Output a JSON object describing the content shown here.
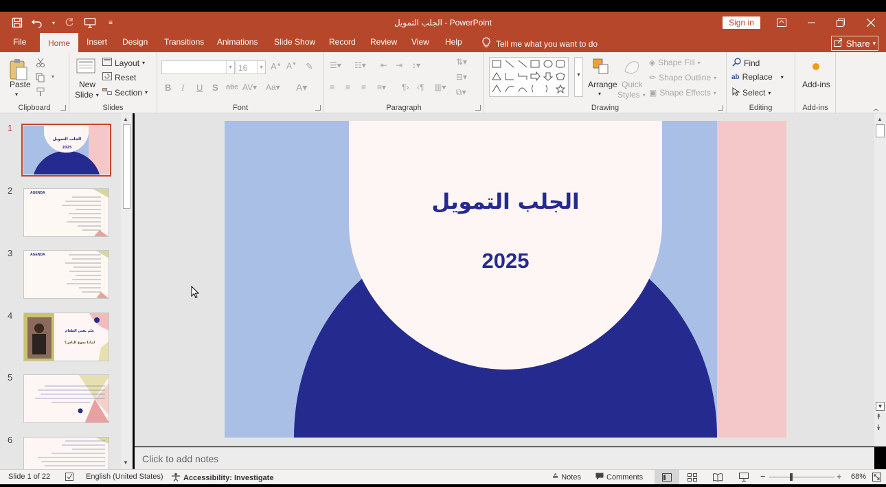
{
  "window": {
    "title": "الجلب التمويل  -  PowerPoint",
    "sign_in": "Sign in"
  },
  "tabs": [
    {
      "label": "File"
    },
    {
      "label": "Home"
    },
    {
      "label": "Insert"
    },
    {
      "label": "Design"
    },
    {
      "label": "Transitions"
    },
    {
      "label": "Animations"
    },
    {
      "label": "Slide Show"
    },
    {
      "label": "Record"
    },
    {
      "label": "Review"
    },
    {
      "label": "View"
    },
    {
      "label": "Help"
    }
  ],
  "tell_me": "Tell me what you want to do",
  "share": "Share",
  "ribbon": {
    "clipboard": {
      "paste": "Paste",
      "label": "Clipboard"
    },
    "slides": {
      "new_slide_1": "New",
      "new_slide_2": "Slide",
      "layout": "Layout",
      "reset": "Reset",
      "section": "Section",
      "label": "Slides"
    },
    "font": {
      "size": "16",
      "label": "Font"
    },
    "paragraph": {
      "label": "Paragraph"
    },
    "drawing": {
      "arrange": "Arrange",
      "quick_styles_1": "Quick",
      "quick_styles_2": "Styles",
      "shape_fill": "Shape Fill",
      "shape_outline": "Shape Outline",
      "shape_effects": "Shape Effects",
      "label": "Drawing"
    },
    "editing": {
      "find": "Find",
      "replace": "Replace",
      "select": "Select",
      "label": "Editing"
    },
    "addins": {
      "addins": "Add-ins",
      "label": "Add-ins"
    }
  },
  "thumbnails": [
    {
      "num": "1",
      "title": "الجلب التمويل",
      "year": "2025"
    },
    {
      "num": "2",
      "heading": "AGENDA"
    },
    {
      "num": "3",
      "heading": "AGENDA"
    },
    {
      "num": "4",
      "title": "علم نفس الطعام",
      "subtitle": "لماذا نجوع الناس؟"
    },
    {
      "num": "5"
    },
    {
      "num": "6"
    }
  ],
  "slide": {
    "title": "الجلب التمويل",
    "year": "2025"
  },
  "notes_placeholder": "Click to add notes",
  "status": {
    "slide_count": "Slide 1 of 22",
    "language": "English (United States)",
    "accessibility": "Accessibility: Investigate",
    "notes": "Notes",
    "comments": "Comments",
    "zoom": "68%"
  },
  "colors": {
    "brand": "#b7472a",
    "slide_navy": "#252a8f",
    "slide_blue": "#aabfe6",
    "slide_pink": "#f4c8c8",
    "slide_cream": "#fdf6f4"
  }
}
